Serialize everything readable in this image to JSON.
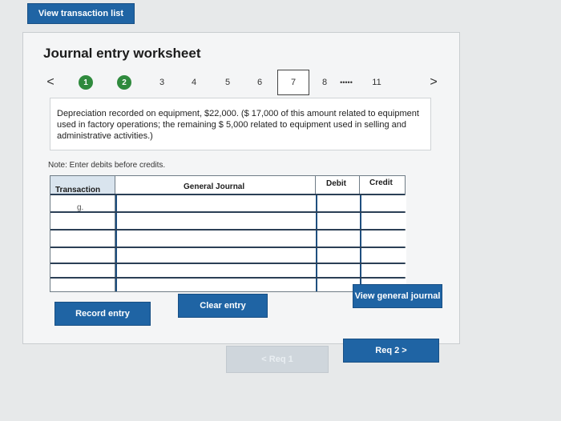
{
  "header": {
    "view_list_label": "View transaction list"
  },
  "worksheet": {
    "title": "Journal entry worksheet",
    "pager": {
      "prev": "<",
      "next": ">",
      "items": [
        "1",
        "2",
        "3",
        "4",
        "5",
        "6",
        "7",
        "8",
        "•••••",
        "11"
      ],
      "current": "7",
      "completed": [
        "1",
        "2"
      ]
    },
    "description": "Depreciation recorded on equipment, $22,000. ($ 17,000 of this amount related to equipment used in factory operations; the remaining $ 5,000 related to equipment used in selling and administrative activities.)",
    "note": "Note: Enter debits before credits.",
    "table": {
      "headers": {
        "transaction": "Transaction",
        "journal": "General Journal",
        "debit": "Debit",
        "credit": "Credit"
      },
      "rows": [
        {
          "transaction": "g.",
          "account": "",
          "debit": "",
          "credit": ""
        },
        {
          "transaction": "",
          "account": "",
          "debit": "",
          "credit": ""
        },
        {
          "transaction": "",
          "account": "",
          "debit": "",
          "credit": ""
        },
        {
          "transaction": "",
          "account": "",
          "debit": "",
          "credit": ""
        },
        {
          "transaction": "",
          "account": "",
          "debit": "",
          "credit": ""
        },
        {
          "transaction": "",
          "account": "",
          "debit": "",
          "credit": ""
        }
      ]
    },
    "buttons": {
      "record": "Record entry",
      "clear": "Clear entry",
      "view_journal": "View general journal"
    }
  },
  "footer": {
    "req1": "< Req 1",
    "req2": "Req 2  >"
  },
  "colors": {
    "primary_button": "#1f64a4",
    "completed_step": "#2f8a3d"
  }
}
